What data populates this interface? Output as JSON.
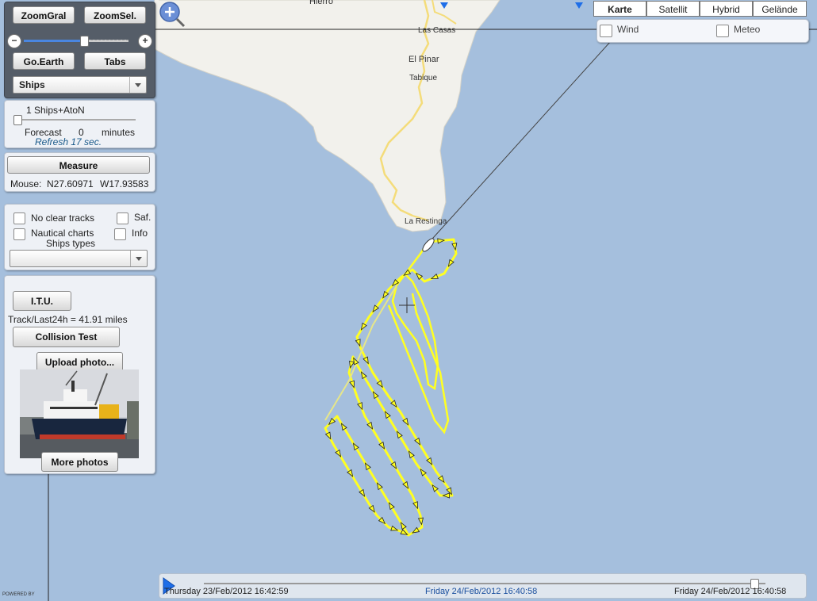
{
  "controls": {
    "zoom_gral": "ZoomGral",
    "zoom_sel": "ZoomSel.",
    "go_earth": "Go.Earth",
    "tabs": "Tabs",
    "ships_select": "Ships"
  },
  "ships_panel": {
    "count_label": "1 Ships+AtoN",
    "forecast_label": "Forecast",
    "forecast_value": "0",
    "forecast_unit": "minutes",
    "refresh": "Refresh 17 sec."
  },
  "measure_panel": {
    "measure_button": "Measure",
    "mouse_label": "Mouse:",
    "mouse_lat": "N27.60971",
    "mouse_lon": "W17.93583"
  },
  "options_panel": {
    "no_clear_tracks": "No clear tracks",
    "saf": "Saf.",
    "nautical_charts": "Nautical charts",
    "info": "Info",
    "ships_types": "Ships types",
    "ships_types_value": ""
  },
  "vessel_panel": {
    "itu_button": "I.T.U.",
    "track_info": "Track/Last24h = 41.91 miles",
    "collision_button": "Collision Test",
    "upload_button": "Upload photo...",
    "more_photos_button": "More photos"
  },
  "map_types": {
    "karte": "Karte",
    "satellit": "Satellit",
    "hybrid": "Hybrid",
    "gelande": "Gelände"
  },
  "overlays": {
    "wind": "Wind",
    "meteo": "Meteo"
  },
  "place_labels": {
    "hierro": "Hierro",
    "las_casas": "Las Casas",
    "el_pinar": "El Pinar",
    "tabique": "Tabique",
    "la_restinga": "La Restinga"
  },
  "timeline": {
    "start": "Thursday 23/Feb/2012  16:42:59",
    "middle": "Friday 24/Feb/2012  16:40:58",
    "end": "Friday 24/Feb/2012  16:40:58",
    "progress": 0.98
  },
  "powered_by": "POWERED BY",
  "colors": {
    "sea": "#a5bfdd",
    "land": "#f2f1ec",
    "track": "#ffff22",
    "road": "#f6e391"
  }
}
